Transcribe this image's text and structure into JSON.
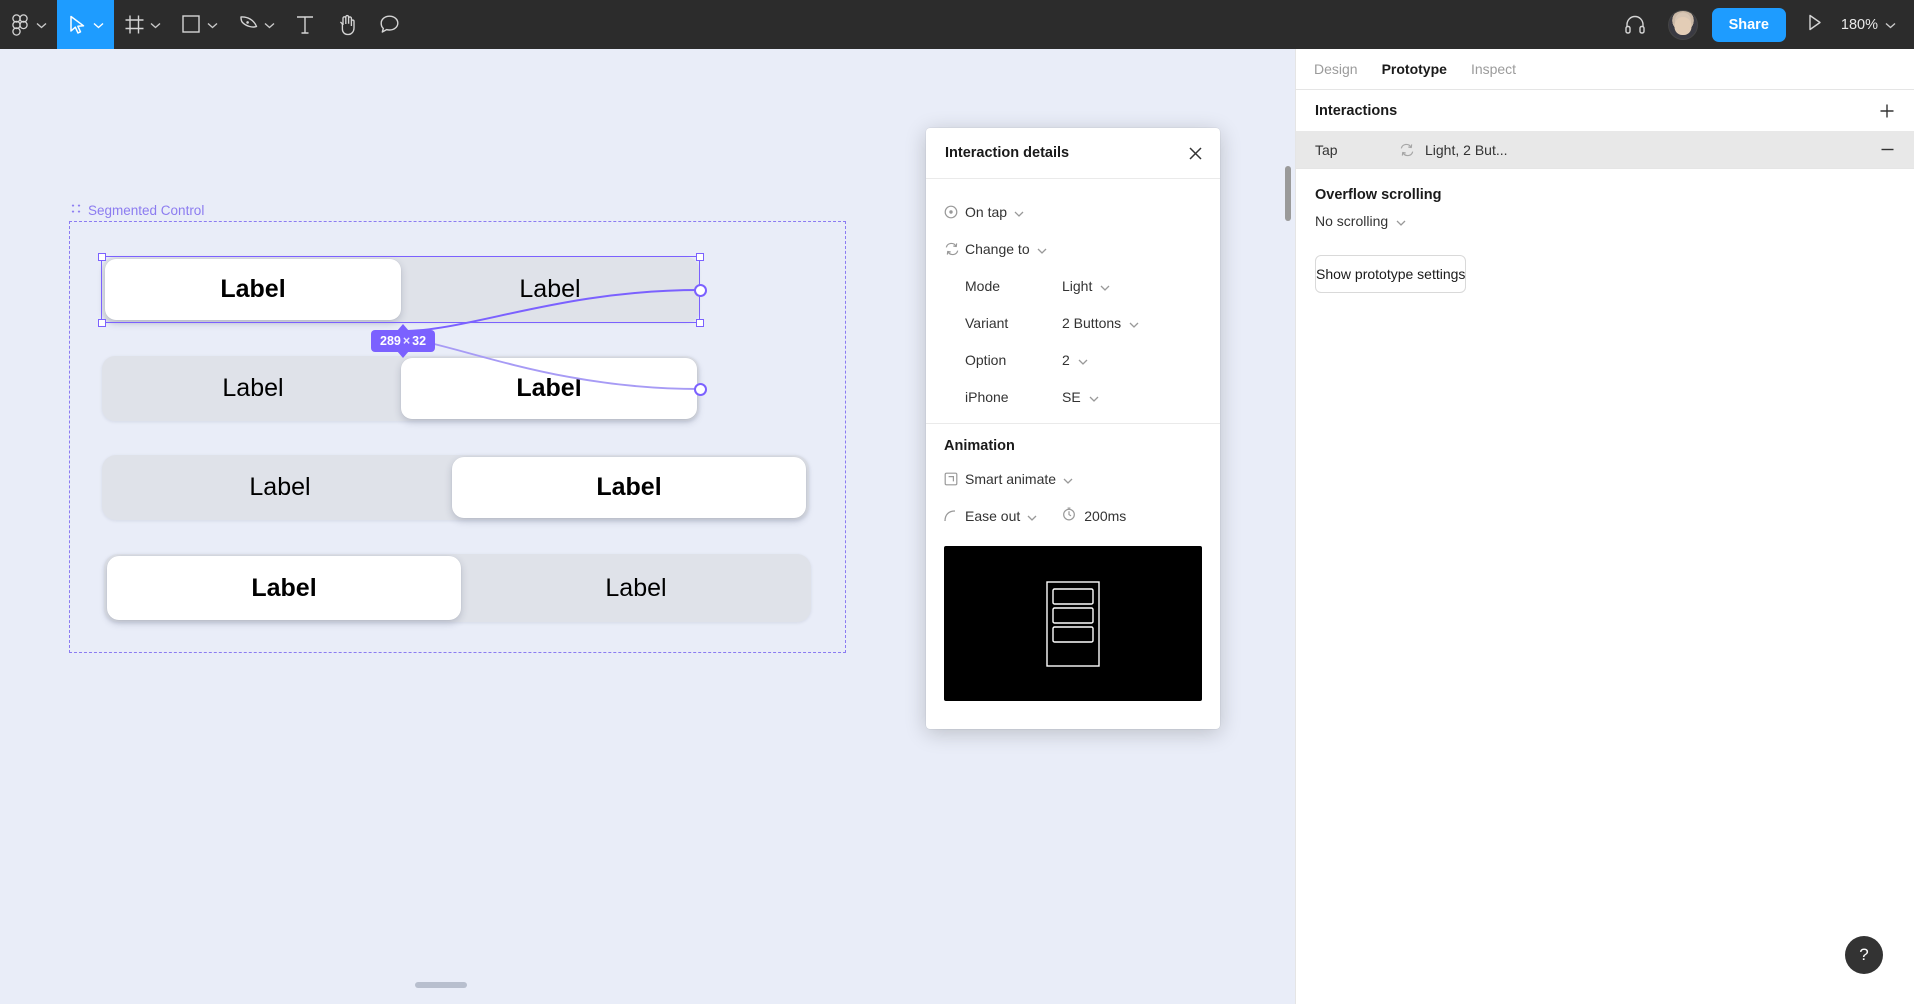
{
  "toolbar": {
    "menu_icon": "figma-logo-icon",
    "tools": [
      {
        "name": "move-tool",
        "icon": "cursor-icon",
        "active": true
      },
      {
        "name": "frame-tool",
        "icon": "frame-icon",
        "active": false
      },
      {
        "name": "shape-tool",
        "icon": "square-icon",
        "active": false
      },
      {
        "name": "pen-tool",
        "icon": "pen-icon",
        "active": false
      },
      {
        "name": "text-tool",
        "icon": "text-icon",
        "active": false
      },
      {
        "name": "hand-tool",
        "icon": "hand-icon",
        "active": false
      },
      {
        "name": "comment-tool",
        "icon": "comment-icon",
        "active": false
      }
    ],
    "headphones_icon": "headphones-icon",
    "share_label": "Share",
    "present_icon": "play-icon",
    "zoom_level": "180%"
  },
  "canvas": {
    "frame_label": "Segmented Control",
    "size_badge": {
      "width": "289",
      "separator": "×",
      "height": "32"
    },
    "segments": [
      {
        "left_label": "Label",
        "right_label": "Label",
        "selected": "left"
      },
      {
        "left_label": "Label",
        "right_label": "Label",
        "selected": "right"
      },
      {
        "left_label": "Label",
        "right_label": "Label",
        "selected": "right"
      },
      {
        "left_label": "Label",
        "right_label": "Label",
        "selected": "left"
      }
    ],
    "selection_color": "#7b61ff"
  },
  "dialog": {
    "title": "Interaction details",
    "close_icon": "close-icon",
    "trigger": {
      "icon": "tap-target-icon",
      "value": "On tap"
    },
    "action": {
      "icon": "change-to-icon",
      "value": "Change to"
    },
    "properties": [
      {
        "label": "Mode",
        "value": "Light"
      },
      {
        "label": "Variant",
        "value": "2 Buttons"
      },
      {
        "label": "Option",
        "value": "2"
      },
      {
        "label": "iPhone",
        "value": "SE"
      }
    ],
    "animation": {
      "section_title": "Animation",
      "type_icon": "smart-animate-icon",
      "type": "Smart animate",
      "easing_icon": "ease-curve-icon",
      "easing": "Ease out",
      "duration_icon": "stopwatch-icon",
      "duration": "200ms"
    },
    "preview_alt": "prototype-preview"
  },
  "right_panel": {
    "tabs": [
      {
        "label": "Design",
        "active": false
      },
      {
        "label": "Prototype",
        "active": true
      },
      {
        "label": "Inspect",
        "active": false
      }
    ],
    "interactions": {
      "title": "Interactions",
      "add_icon": "plus-icon",
      "rows": [
        {
          "trigger": "Tap",
          "icon": "change-to-icon",
          "destination": "Light, 2 But...",
          "remove_icon": "minus-icon"
        }
      ]
    },
    "overflow": {
      "title": "Overflow scrolling",
      "value": "No scrolling"
    },
    "prototype_settings_label": "Show prototype settings"
  },
  "help": {
    "label": "?"
  }
}
